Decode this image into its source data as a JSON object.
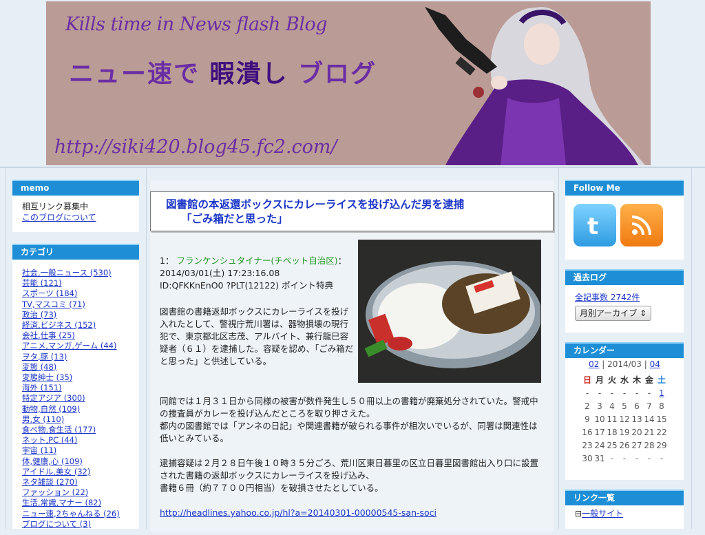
{
  "banner": {
    "en_title": "Kills time in News flash Blog",
    "jp_title_a": "ニュー速で ",
    "jp_title_b": "暇潰し",
    "jp_title_c": " ブログ",
    "url": "http://siki420.blog45.fc2.com/"
  },
  "left": {
    "memo": {
      "head": "memo",
      "line1": "相互リンク募集中",
      "link": "このブログについて"
    },
    "categories": {
      "head": "カテゴリ",
      "items": [
        "社会,一般ニュース (530)",
        "芸能 (121)",
        "スポーツ (184)",
        "TV,マスコミ (71)",
        "政治 (73)",
        "経済,ビジネス (152)",
        "会社,仕事 (25)",
        "アニメ,マンガ,ゲーム (44)",
        "ヲタ,豚 (13)",
        "変態 (48)",
        "変態紳士 (35)",
        "海外 (151)",
        "特定アジア (300)",
        "動物,自然 (109)",
        "男,女 (110)",
        "食べ物,食生活 (177)",
        "ネット,PC (44)",
        "宇宙 (11)",
        "体,健康,心 (109)",
        "アイドル,美女 (32)",
        "ネタ雑談 (270)",
        "ファッション (22)",
        "生活,常識,マナー (82)",
        "ニュー速,2ちゃんねる (26)",
        "ブログについて (3)"
      ]
    }
  },
  "article": {
    "title_line1": "図書館の本返還ボックスにカレーライスを投げ込んだ男を逮捕",
    "title_line2": "「ごみ箱だと思った」",
    "meta_num": "1：",
    "meta_name": "フランケンシュタイナー(チベット自治区)",
    "meta_date": "：2014/03/01(土) 17:23:16.08",
    "meta_id": "ID:QFKKnEnO0 ?PLT(12122) ポイント特典",
    "lead": "図書館の書籍返却ボックスにカレーライスを投げ入れたとして、警視庁荒川署は、器物損壊の現行犯で、東京都北区志茂、アルバイト、兼行龍巳容疑者（６１）を逮捕した。容疑を認め、「ごみ箱だと思った」と供述している。",
    "p1": "同館では１月３１日から同様の被害が数件発生し５０冊以上の書籍が廃棄処分されていた。警戒中の捜査員がカレーを投げ込んだところを取り押さえた。",
    "p1b": "都内の図書館では「アンネの日記」や関連書籍が破られる事件が相次いでいるが、同署は関連性は低いとみている。",
    "p2": "逮捕容疑は２月２８日午後１０時３５分ごろ、荒川区東日暮里の区立日暮里図書館出入り口に設置された書籍の返却ボックスにカレーライスを投げ込み、",
    "p2b": "書籍６冊（約７７００円相当）を破損させたとしている。",
    "link": "http://headlines.yahoo.co.jp/hl?a=20140301-00000545-san-soci"
  },
  "right": {
    "follow": {
      "head": "Follow Me"
    },
    "archive": {
      "head": "過去ログ",
      "count_link": "全記事数 2742件",
      "select": "月別アーカイブ"
    },
    "calendar": {
      "head": "カレンダー",
      "prev": "02",
      "sep1": " | 2014/03 | ",
      "next": "04",
      "weekdays": [
        "日",
        "月",
        "火",
        "水",
        "木",
        "金",
        "土"
      ],
      "weeks": [
        [
          "-",
          "-",
          "-",
          "-",
          "-",
          "-",
          "1"
        ],
        [
          "2",
          "3",
          "4",
          "5",
          "6",
          "7",
          "8"
        ],
        [
          "9",
          "10",
          "11",
          "12",
          "13",
          "14",
          "15"
        ],
        [
          "16",
          "17",
          "18",
          "19",
          "20",
          "21",
          "22"
        ],
        [
          "23",
          "24",
          "25",
          "26",
          "27",
          "28",
          "29"
        ],
        [
          "30",
          "31",
          "-",
          "-",
          "-",
          "-",
          "-"
        ]
      ]
    },
    "links": {
      "head": "リンク一覧",
      "first": "一般サイト"
    }
  },
  "colors": {
    "sidebar_head": "#1e8fd6",
    "link": "#1a35c8",
    "banner_bg": "#bb9b95",
    "title_purple": "#6a2ea4"
  }
}
